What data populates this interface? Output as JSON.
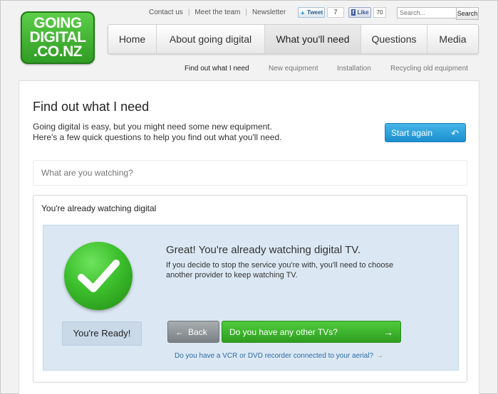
{
  "logo": {
    "line1": "GOING",
    "line2": "DIGITAL",
    "line3": ".CO.NZ"
  },
  "utility": {
    "links": [
      "Contact us",
      "Meet the team",
      "Newsletter"
    ],
    "tweet_label": "Tweet",
    "tweet_count": "7",
    "like_label": "Like",
    "like_count": "70",
    "search_placeholder": "Search...",
    "search_button": "Search"
  },
  "nav": {
    "items": [
      "Home",
      "About going digital",
      "What you'll need",
      "Questions",
      "Media"
    ],
    "active": "What you'll need"
  },
  "subnav": {
    "items": [
      "Find out what I need",
      "New equipment",
      "Installation",
      "Recycling old equipment"
    ]
  },
  "page": {
    "title": "Find out what I need",
    "intro_line1": "Going digital is easy, but you might need some new equipment.",
    "intro_line2": "Here's a few quick questions to help you find out what you'll need.",
    "start_again": "Start again",
    "question_placeholder": "What are you watching?"
  },
  "result": {
    "title": "You're already watching digital",
    "ready_label": "You're Ready!",
    "headline": "Great! You're already watching digital TV.",
    "detail_line1": "If you decide to stop the service you're with, you'll need to choose",
    "detail_line2": "another provider to keep watching TV.",
    "back_label": "Back",
    "next_label": "Do you have any other TVs?",
    "vcr_link": "Do you have a VCR or DVD recorder connected to your aerial?"
  },
  "colors": {
    "brand_green": "#3cbf2c",
    "accent_blue": "#1c8fce",
    "panel_blue": "#dbe8f3",
    "link_blue": "#2c6aa8"
  }
}
